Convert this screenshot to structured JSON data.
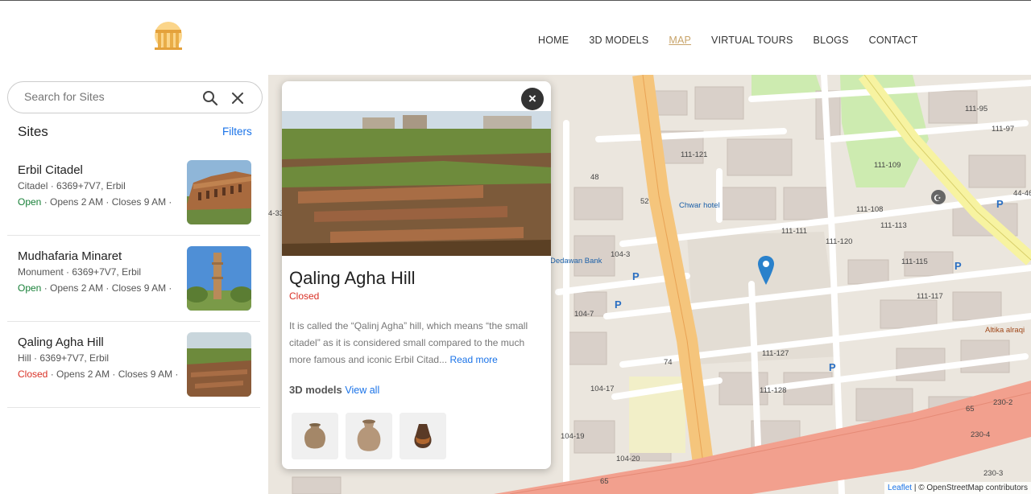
{
  "nav": {
    "items": [
      "HOME",
      "3D MODELS",
      "MAP",
      "VIRTUAL TOURS",
      "BLOGS",
      "CONTACT"
    ],
    "active": "MAP"
  },
  "search": {
    "placeholder": "Search for Sites",
    "value": ""
  },
  "sidebar": {
    "title": "Sites",
    "filters_label": "Filters",
    "sites": [
      {
        "name": "Erbil Citadel",
        "meta": "Citadel · 6369+7V7, Erbil",
        "status": "Open",
        "hours": " · Opens 2 AM · Closes 9 AM ·"
      },
      {
        "name": "Mudhafaria Minaret",
        "meta": "Monument · 6369+7V7, Erbil",
        "status": "Open",
        "hours": " · Opens 2 AM · Closes 9 AM ·"
      },
      {
        "name": "Qaling Agha Hill",
        "meta": "Hill · 6369+7V7, Erbil",
        "status": "Closed",
        "hours": " · Opens 2 AM · Closes 9 AM ·"
      }
    ]
  },
  "popup": {
    "close_label": "×",
    "title": "Qaling Agha Hill",
    "status": "Closed",
    "description": "It is called the “Qalinj Agha” hill, which means “the small citadel” as it is considered small compared to the much more famous and iconic Erbil Citad...",
    "read_more": "Read more",
    "models_label": "3D models",
    "view_all": "View all"
  },
  "map": {
    "attribution_link": "Leaflet",
    "attribution_text": " | © OpenStreetMap contributors",
    "labels": {
      "road_111_111": "111-111",
      "road_111_121": "111-121",
      "road_111_113": "111-113",
      "road_111_115": "111-115",
      "road_111_117": "111-117",
      "road_111_127": "111-127",
      "road_111_128": "111-128",
      "road_111_120": "111-120",
      "road_111_108": "111-108",
      "road_111_109": "111-109",
      "road_111_95": "111-95",
      "road_111_97": "111-97",
      "road_104_3": "104-3",
      "road_104_7": "104-7",
      "road_104_17": "104-17",
      "road_104_19": "104-19",
      "road_104_20": "104-20",
      "road_65a": "65",
      "road_65b": "65",
      "road_230_2": "230-2",
      "road_230_4": "230-4",
      "road_230_3": "230-3",
      "road_4_33": "4-33",
      "num_48": "48",
      "num_52": "52",
      "num_74": "74",
      "chwar_hotel": "Chwar hotel",
      "dedawan_bank": "Dedawan Bank",
      "altika": "Altika alraqi",
      "edge_44": "44-46",
      "edge_p": "P"
    }
  },
  "colors": {
    "accent": "#c8a46a",
    "link": "#1a73e8",
    "open": "#188038",
    "closed": "#d93025",
    "pin": "#2a81cb"
  }
}
